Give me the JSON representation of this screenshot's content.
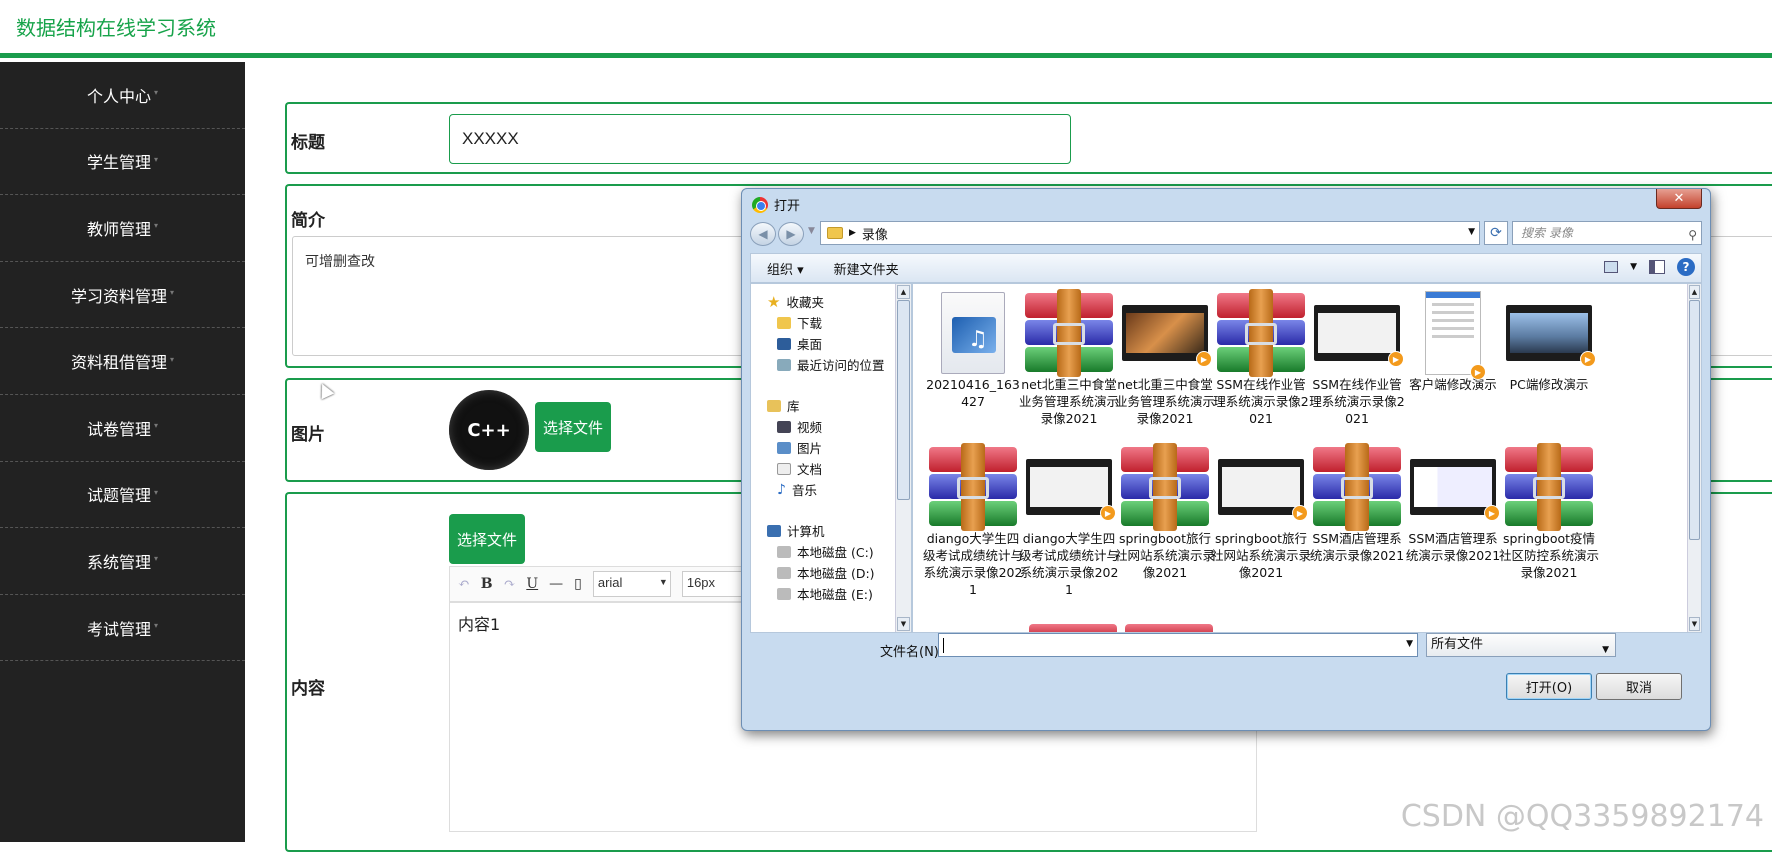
{
  "app": {
    "title": "数据结构在线学习系统"
  },
  "sidebar": {
    "items": [
      {
        "label": "个人中心"
      },
      {
        "label": "学生管理"
      },
      {
        "label": "教师管理"
      },
      {
        "label": "学习资料管理"
      },
      {
        "label": "资料租借管理"
      },
      {
        "label": "试卷管理"
      },
      {
        "label": "试题管理"
      },
      {
        "label": "系统管理"
      },
      {
        "label": "考试管理"
      }
    ]
  },
  "form": {
    "title_label": "标题",
    "title_value": "XXXXX",
    "intro_label": "简介",
    "intro_value": "可增删查改",
    "image_label": "图片",
    "image_avatar_text": "C++",
    "image_button": "选择文件",
    "content_label": "内容",
    "content_button": "选择文件",
    "editor": {
      "font": "arial",
      "size": "16px",
      "bold": "B",
      "underline": "U",
      "hr": "—",
      "body": "内容1"
    }
  },
  "watermark": "CSDN @QQ3359892174",
  "dialog": {
    "title": "打开",
    "close": "✕",
    "path": "录像",
    "search_placeholder": "搜索 录像",
    "organize": "组织 ▾",
    "new_folder": "新建文件夹",
    "help": "?",
    "nav": {
      "favorites": "收藏夹",
      "downloads": "下载",
      "desktop": "桌面",
      "recent": "最近访问的位置",
      "library": "库",
      "videos": "视频",
      "pictures": "图片",
      "documents": "文档",
      "music": "音乐",
      "computer": "计算机",
      "disk_c": "本地磁盘 (C:)",
      "disk_d": "本地磁盘 (D:)",
      "disk_e": "本地磁盘 (E:)"
    },
    "files": [
      {
        "name": "20210416_163427",
        "kind": "media"
      },
      {
        "name": "net北重三中食堂业务管理系统演示录像2021",
        "kind": "rar"
      },
      {
        "name": "net北重三中食堂业务管理系统演示录像2021",
        "kind": "video-food"
      },
      {
        "name": "SSM在线作业管理系统演示录像2021",
        "kind": "rar"
      },
      {
        "name": "SSM在线作业管理系统演示录像2021",
        "kind": "video-light"
      },
      {
        "name": "客户端修改演示",
        "kind": "tall"
      },
      {
        "name": "PC端修改演示",
        "kind": "video-city"
      },
      {
        "name": "diango大学生四级考试成绩统计与系统演示录像2021",
        "kind": "rar"
      },
      {
        "name": "diango大学生四级考试成绩统计与系统演示录像2021",
        "kind": "video-light"
      },
      {
        "name": "springboot旅行社网站系统演示录像2021",
        "kind": "rar"
      },
      {
        "name": "springboot旅行社网站系统演示录像2021",
        "kind": "video-light"
      },
      {
        "name": "SSM酒店管理系统演示录像2021",
        "kind": "rar"
      },
      {
        "name": "SSM酒店管理系统演示录像2021",
        "kind": "video-light"
      },
      {
        "name": "springboot疫情社区防控系统演示录像2021",
        "kind": "rar"
      }
    ],
    "filename_label": "文件名(N):",
    "filename_value": "",
    "filetype": "所有文件",
    "open_button": "打开(O)",
    "cancel_button": "取消"
  },
  "colors": {
    "accent": "#1a9c4c",
    "sidebar_bg": "#222222"
  }
}
